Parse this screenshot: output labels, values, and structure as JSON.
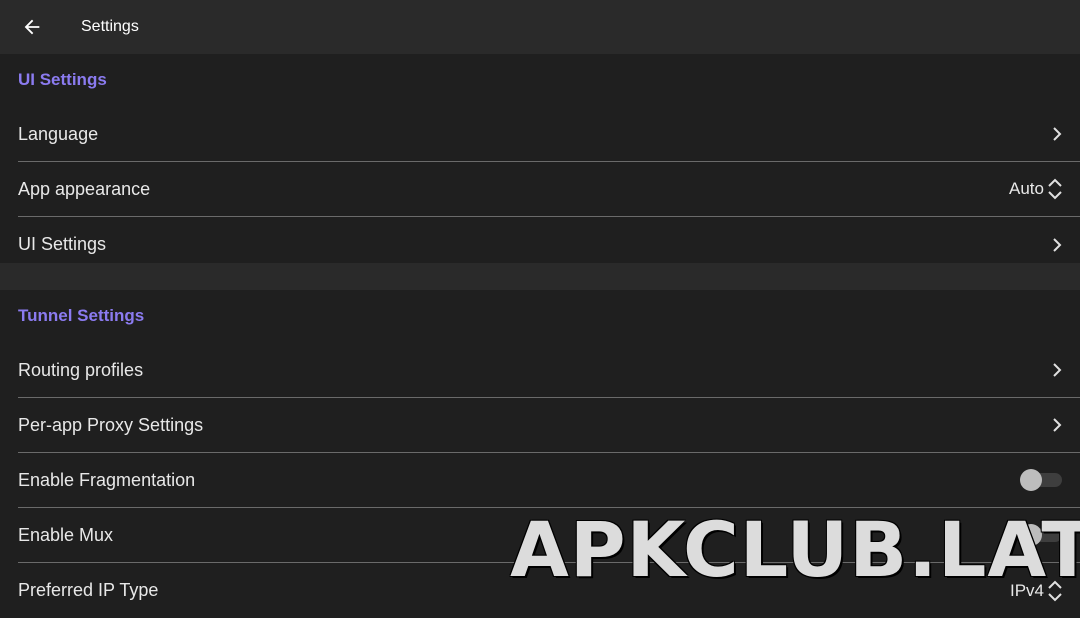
{
  "header": {
    "title": "Settings",
    "back_icon": "arrow-back-icon"
  },
  "sections": [
    {
      "title": "UI Settings",
      "rows": [
        {
          "label": "Language",
          "control": "chevron"
        },
        {
          "label": "App appearance",
          "control": "select",
          "value": "Auto"
        },
        {
          "label": "UI Settings",
          "control": "chevron"
        }
      ]
    },
    {
      "title": "Tunnel Settings",
      "rows": [
        {
          "label": "Routing profiles",
          "control": "chevron"
        },
        {
          "label": "Per-app Proxy Settings",
          "control": "chevron"
        },
        {
          "label": "Enable Fragmentation",
          "control": "toggle",
          "enabled": false
        },
        {
          "label": "Enable Mux",
          "control": "toggle",
          "enabled": false
        },
        {
          "label": "Preferred IP Type",
          "control": "select",
          "value": "IPv4"
        }
      ]
    }
  ],
  "watermark": "APKCLUB.LAT",
  "colors": {
    "accent": "#8b7bf0",
    "background": "#1f1f1f",
    "topbar": "#2a2a2a"
  }
}
